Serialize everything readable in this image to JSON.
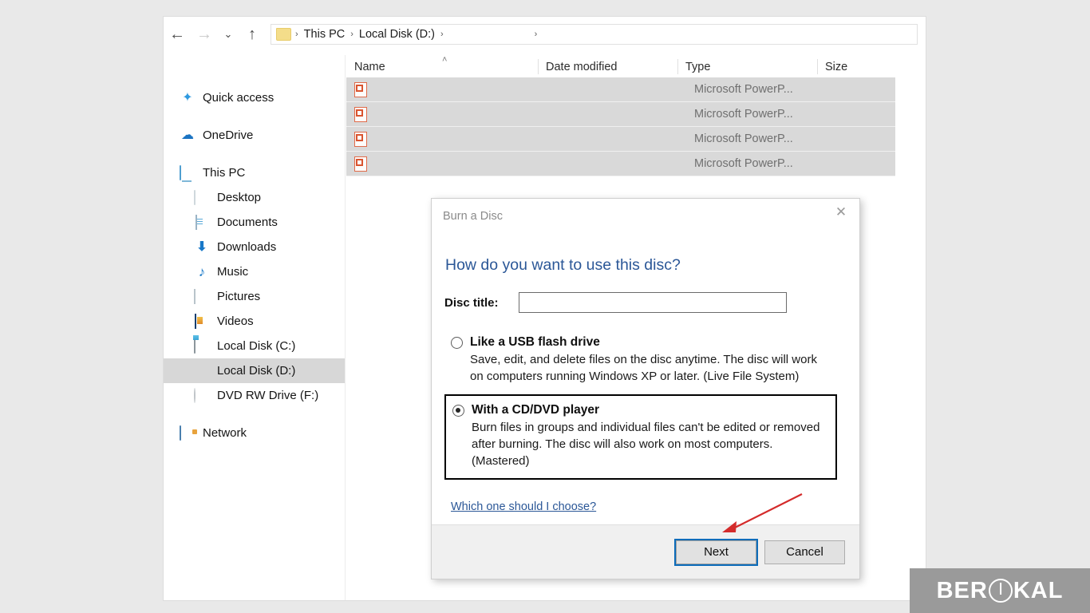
{
  "explorer": {
    "nav": {
      "back_icon": "arrow-left",
      "forward_icon": "arrow-right",
      "recent_icon": "chevron-down",
      "up_icon": "arrow-up"
    },
    "breadcrumb": {
      "folder_icon": "folder-icon",
      "items": [
        "This PC",
        "Local Disk (D:)"
      ],
      "separator": "›",
      "redacted_trailing": true
    },
    "columns": [
      {
        "label": "Name",
        "sorted": true,
        "sort_caret": "˄"
      },
      {
        "label": "Date modified",
        "sorted": false
      },
      {
        "label": "Type",
        "sorted": false
      },
      {
        "label": "Size",
        "sorted": false
      }
    ],
    "sidebar": [
      {
        "label": "Quick access",
        "icon": "star-icon",
        "indent": false,
        "selected": false,
        "gap": false
      },
      {
        "label": "OneDrive",
        "icon": "cloud-icon",
        "indent": false,
        "selected": false,
        "gap": true
      },
      {
        "label": "This PC",
        "icon": "monitor-icon",
        "indent": false,
        "selected": false,
        "gap": true
      },
      {
        "label": "Desktop",
        "icon": "desktop-icon",
        "indent": true,
        "selected": false,
        "gap": false
      },
      {
        "label": "Documents",
        "icon": "document-icon",
        "indent": true,
        "selected": false,
        "gap": false
      },
      {
        "label": "Downloads",
        "icon": "download-icon",
        "indent": true,
        "selected": false,
        "gap": false
      },
      {
        "label": "Music",
        "icon": "music-note-icon",
        "indent": true,
        "selected": false,
        "gap": false
      },
      {
        "label": "Pictures",
        "icon": "picture-icon",
        "indent": true,
        "selected": false,
        "gap": false
      },
      {
        "label": "Videos",
        "icon": "video-icon",
        "indent": true,
        "selected": false,
        "gap": false
      },
      {
        "label": "Local Disk (C:)",
        "icon": "hard-drive-system-icon",
        "indent": true,
        "selected": false,
        "gap": false
      },
      {
        "label": "Local Disk (D:)",
        "icon": "hard-drive-icon",
        "indent": true,
        "selected": true,
        "gap": false
      },
      {
        "label": "DVD RW Drive (F:)",
        "icon": "optical-disc-icon",
        "indent": true,
        "selected": false,
        "gap": false
      },
      {
        "label": "Network",
        "icon": "network-icon",
        "indent": false,
        "selected": false,
        "gap": true
      }
    ],
    "files": [
      {
        "name": "",
        "date_modified": "",
        "type": "Microsoft PowerP...",
        "size": "",
        "icon": "powerpoint-file-icon"
      },
      {
        "name": "",
        "date_modified": "",
        "type": "Microsoft PowerP...",
        "size": "",
        "icon": "powerpoint-file-icon"
      },
      {
        "name": "",
        "date_modified": "",
        "type": "Microsoft PowerP...",
        "size": "",
        "icon": "powerpoint-file-icon"
      },
      {
        "name": "",
        "date_modified": "",
        "type": "Microsoft PowerP...",
        "size": "",
        "icon": "powerpoint-file-icon"
      }
    ]
  },
  "dialog": {
    "title": "Burn a Disc",
    "close_icon": "close-icon",
    "heading": "How do you want to use this disc?",
    "disc_title_label": "Disc title:",
    "disc_title_value": "",
    "disc_title_placeholder": "",
    "options": [
      {
        "title": "Like a USB flash drive",
        "description": "Save, edit, and delete files on the disc anytime. The disc will work on computers running Windows XP or later. (Live File System)",
        "selected": false,
        "highlighted": false
      },
      {
        "title": "With a CD/DVD player",
        "description": "Burn files in groups and individual files can't be edited or removed after burning. The disc will also work on most computers. (Mastered)",
        "selected": true,
        "highlighted": true
      }
    ],
    "help_link": "Which one should I choose?",
    "buttons": {
      "primary": "Next",
      "secondary": "Cancel"
    }
  },
  "annotation": {
    "arrow_color": "#d42b2b",
    "points_to": "Next"
  },
  "watermark": {
    "text_before": "BER",
    "text_after": "KAL",
    "leaf_icon": "leaf-icon",
    "background": "#9a9a9a"
  }
}
